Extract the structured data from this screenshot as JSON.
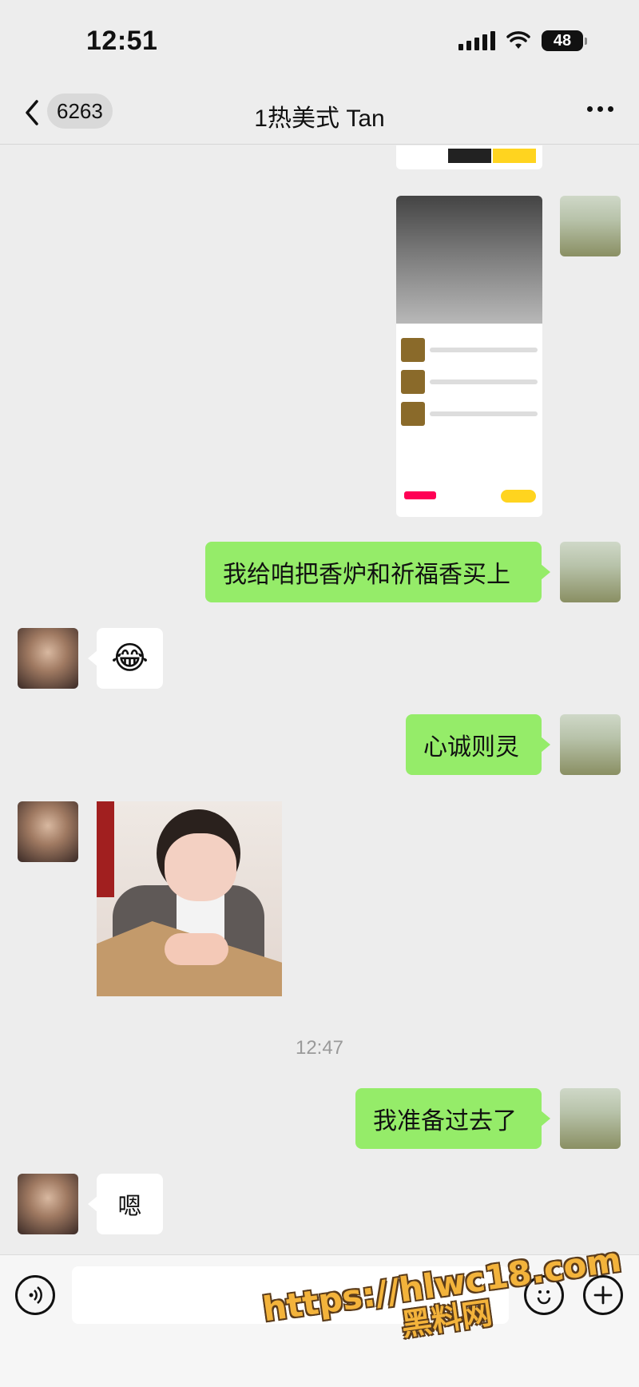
{
  "status_bar": {
    "time": "12:51",
    "battery": "48"
  },
  "nav": {
    "unread_count": "6263",
    "title": "1热美式 Tan"
  },
  "messages": {
    "m1_text": "我给咱把香炉和祈福香买上",
    "m2_emoji": "😂",
    "m3_text": "心诚则灵",
    "timestamp": "12:47",
    "m5_text": "我准备过去了",
    "m6_text": "嗯"
  },
  "input_bar": {
    "placeholder": ""
  },
  "watermark": {
    "url": "https://hlwc18.com",
    "site": "黑料网"
  },
  "colors": {
    "my_bubble": "#95ec69",
    "other_bubble": "#ffffff",
    "background": "#ededed"
  }
}
